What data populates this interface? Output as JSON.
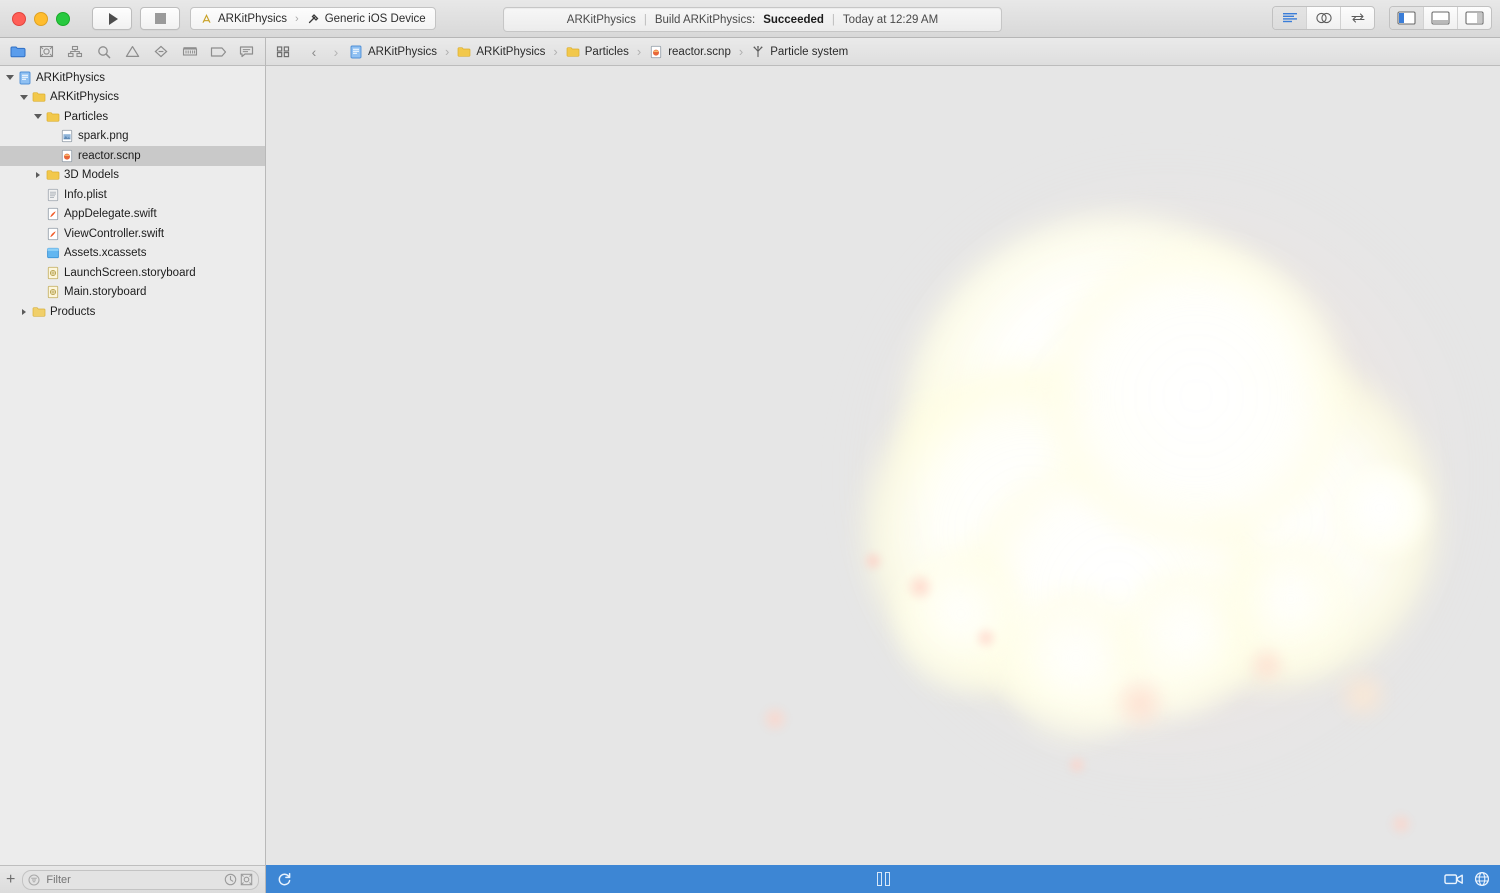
{
  "window": {
    "traffic_lights": [
      "close",
      "minimize",
      "maximize"
    ],
    "colors": {
      "accent_blue": "#3d86d4",
      "canvas_bg": "#e6e6e6",
      "nav_bg": "#ececec",
      "selection": "#c9c9c9",
      "active_icon": "#3a7dd8"
    }
  },
  "toolbar": {
    "run_button": "run-button",
    "stop_button": "stop-button",
    "scheme": {
      "project": "ARKitPhysics",
      "destination": "Generic iOS Device",
      "separator": "›"
    },
    "status": {
      "project": "ARKitPhysics",
      "activity": "Build ARKitPhysics:",
      "result": "Succeeded",
      "time": "Today at 12:29 AM",
      "separator": "|"
    },
    "right_segments": {
      "editor": [
        {
          "name": "standard-editor",
          "active": true
        },
        {
          "name": "assistant-editor",
          "active": false
        },
        {
          "name": "version-editor",
          "active": false
        }
      ],
      "panels": [
        {
          "name": "navigator-toggle",
          "active": true
        },
        {
          "name": "debug-area-toggle",
          "active": false
        },
        {
          "name": "inspector-toggle",
          "active": false
        }
      ]
    }
  },
  "navigator": {
    "tabs": [
      {
        "name": "project-navigator",
        "icon": "folder-icon",
        "active": true
      },
      {
        "name": "source-control-navigator",
        "icon": "source-control-icon",
        "active": false
      },
      {
        "name": "symbol-navigator",
        "icon": "symbol-icon",
        "active": false
      },
      {
        "name": "find-navigator",
        "icon": "search-icon",
        "active": false
      },
      {
        "name": "issue-navigator",
        "icon": "warning-icon",
        "active": false
      },
      {
        "name": "test-navigator",
        "icon": "diamond-icon",
        "active": false
      },
      {
        "name": "debug-navigator",
        "icon": "debug-icon",
        "active": false
      },
      {
        "name": "breakpoint-navigator",
        "icon": "breakpoint-icon",
        "active": false
      },
      {
        "name": "report-navigator",
        "icon": "report-icon",
        "active": false
      }
    ],
    "tree": [
      {
        "label": "ARKitPhysics",
        "indent": 0,
        "icon": "project-icon",
        "disclosure": "open",
        "selected": false
      },
      {
        "label": "ARKitPhysics",
        "indent": 1,
        "icon": "folder-icon",
        "disclosure": "open",
        "selected": false
      },
      {
        "label": "Particles",
        "indent": 2,
        "icon": "folder-icon",
        "disclosure": "open",
        "selected": false
      },
      {
        "label": "spark.png",
        "indent": 3,
        "icon": "image-file-icon",
        "disclosure": "none",
        "selected": false
      },
      {
        "label": "reactor.scnp",
        "indent": 3,
        "icon": "scnp-file-icon",
        "disclosure": "none",
        "selected": true
      },
      {
        "label": "3D Models",
        "indent": 2,
        "icon": "folder-icon",
        "disclosure": "closed",
        "selected": false
      },
      {
        "label": "Info.plist",
        "indent": 2,
        "icon": "plist-file-icon",
        "disclosure": "none",
        "selected": false
      },
      {
        "label": "AppDelegate.swift",
        "indent": 2,
        "icon": "swift-file-icon",
        "disclosure": "none",
        "selected": false
      },
      {
        "label": "ViewController.swift",
        "indent": 2,
        "icon": "swift-file-icon",
        "disclosure": "none",
        "selected": false
      },
      {
        "label": "Assets.xcassets",
        "indent": 2,
        "icon": "assets-catalog-icon",
        "disclosure": "none",
        "selected": false
      },
      {
        "label": "LaunchScreen.storyboard",
        "indent": 2,
        "icon": "storyboard-file-icon",
        "disclosure": "none",
        "selected": false
      },
      {
        "label": "Main.storyboard",
        "indent": 2,
        "icon": "storyboard-file-icon",
        "disclosure": "none",
        "selected": false
      },
      {
        "label": "Products",
        "indent": 1,
        "icon": "products-folder-icon",
        "disclosure": "closed",
        "selected": false
      }
    ],
    "footer": {
      "add_label": "+",
      "filter_placeholder": "Filter",
      "filter_value": "",
      "recent_toggle": "recent-files-icon",
      "source_control_toggle": "source-control-filter-icon"
    }
  },
  "editor": {
    "jump_bar": {
      "grid_icon": "related-items-icon",
      "back": "‹",
      "forward": "›",
      "separator": "›",
      "crumbs": [
        {
          "label": "ARKitPhysics",
          "icon": "project-icon"
        },
        {
          "label": "ARKitPhysics",
          "icon": "folder-icon"
        },
        {
          "label": "Particles",
          "icon": "folder-icon"
        },
        {
          "label": "reactor.scnp",
          "icon": "scnp-file-icon"
        },
        {
          "label": "Particle system",
          "icon": "particle-system-icon"
        }
      ]
    },
    "canvas": {
      "name": "particle-system-preview",
      "description": "SceneKit particle system preview — large soft white-yellow glow with pale pink sparks"
    },
    "scene_bar": {
      "reload_icon": "reload-particle-icon",
      "pause_icon": "pause-icon",
      "record_icon": "record-video-icon",
      "scene_icon": "scene-globe-icon"
    }
  }
}
